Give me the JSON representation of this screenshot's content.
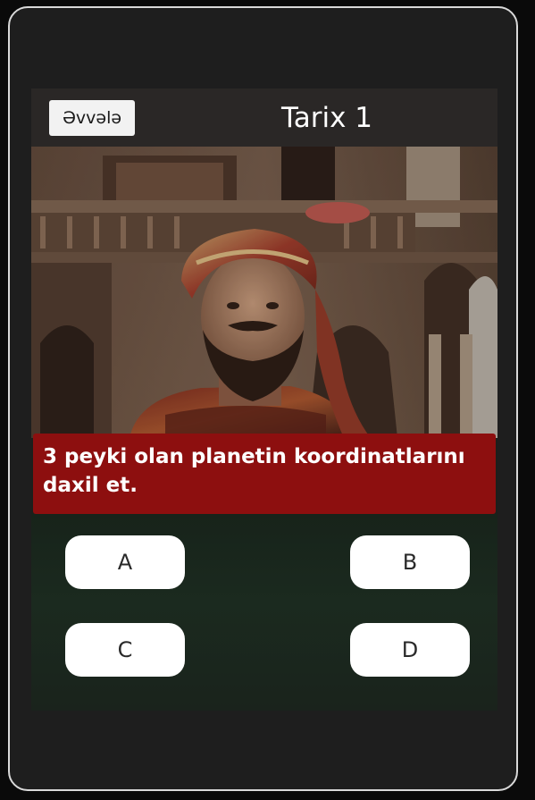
{
  "header": {
    "back_label": "Əvvələ",
    "title": "Tarix 1"
  },
  "illustration": {
    "description_icon": "historical-portrait-image"
  },
  "question": {
    "text": "3 peyki olan planetin koordinatlarını daxil et."
  },
  "answers": {
    "a": "A",
    "b": "B",
    "c": "C",
    "d": "D"
  },
  "colors": {
    "question_background": "#8d0f0f",
    "header_background": "#2a2726",
    "button_background": "#ffffff"
  }
}
